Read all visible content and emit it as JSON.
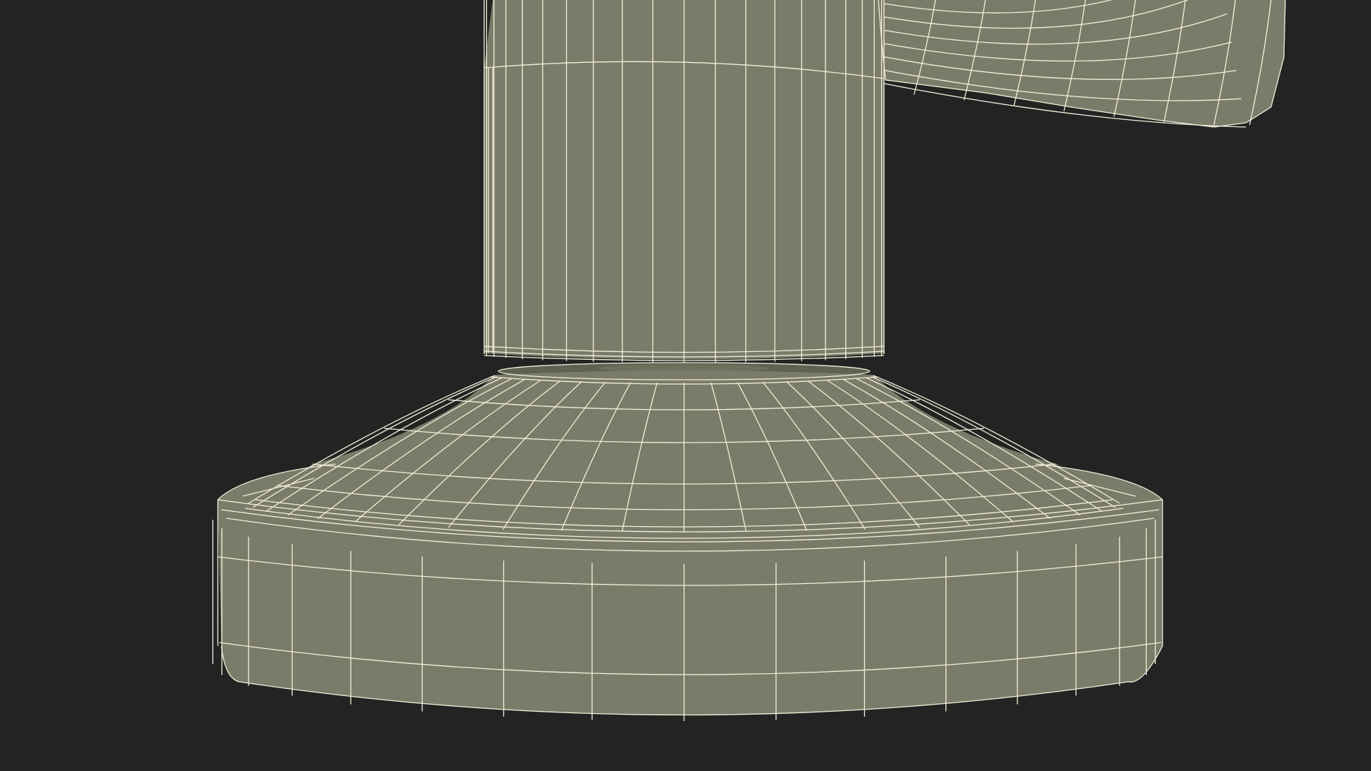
{
  "viewport": {
    "background_color": "#232323"
  },
  "model": {
    "description_name": "faucet-base-wireframe",
    "surface_color": "#7a7c69",
    "surface_dark_color": "#6e705e",
    "wire_color": "#f2f0dc"
  }
}
